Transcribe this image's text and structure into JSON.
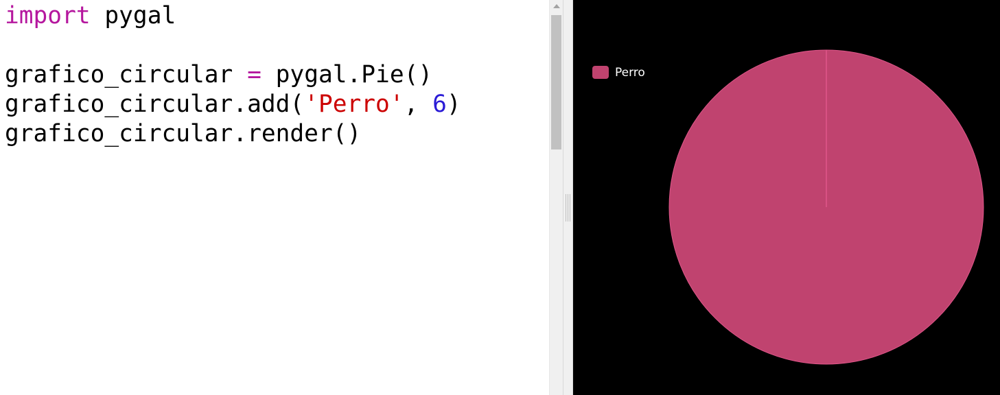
{
  "editor": {
    "lines": [
      [
        {
          "t": "import",
          "c": "kw"
        },
        {
          "t": " pygal",
          "c": ""
        }
      ],
      [],
      [
        {
          "t": "grafico_circular ",
          "c": ""
        },
        {
          "t": "=",
          "c": "op"
        },
        {
          "t": " pygal.Pie()",
          "c": ""
        }
      ],
      [
        {
          "t": "grafico_circular.add(",
          "c": ""
        },
        {
          "t": "'Perro'",
          "c": "str"
        },
        {
          "t": ", ",
          "c": ""
        },
        {
          "t": "6",
          "c": "num"
        },
        {
          "t": ")",
          "c": ""
        }
      ],
      [
        {
          "t": "grafico_circular.render()",
          "c": ""
        }
      ]
    ]
  },
  "colors": {
    "keyword": "#b5179e",
    "string": "#cc0000",
    "number": "#2a1bd6",
    "chart_background": "#000000",
    "slice": "#c0436f"
  },
  "chart_data": {
    "type": "pie",
    "series": [
      {
        "name": "Perro",
        "values": [
          6
        ],
        "color": "#c0436f"
      }
    ],
    "legend_position": "top-left"
  }
}
